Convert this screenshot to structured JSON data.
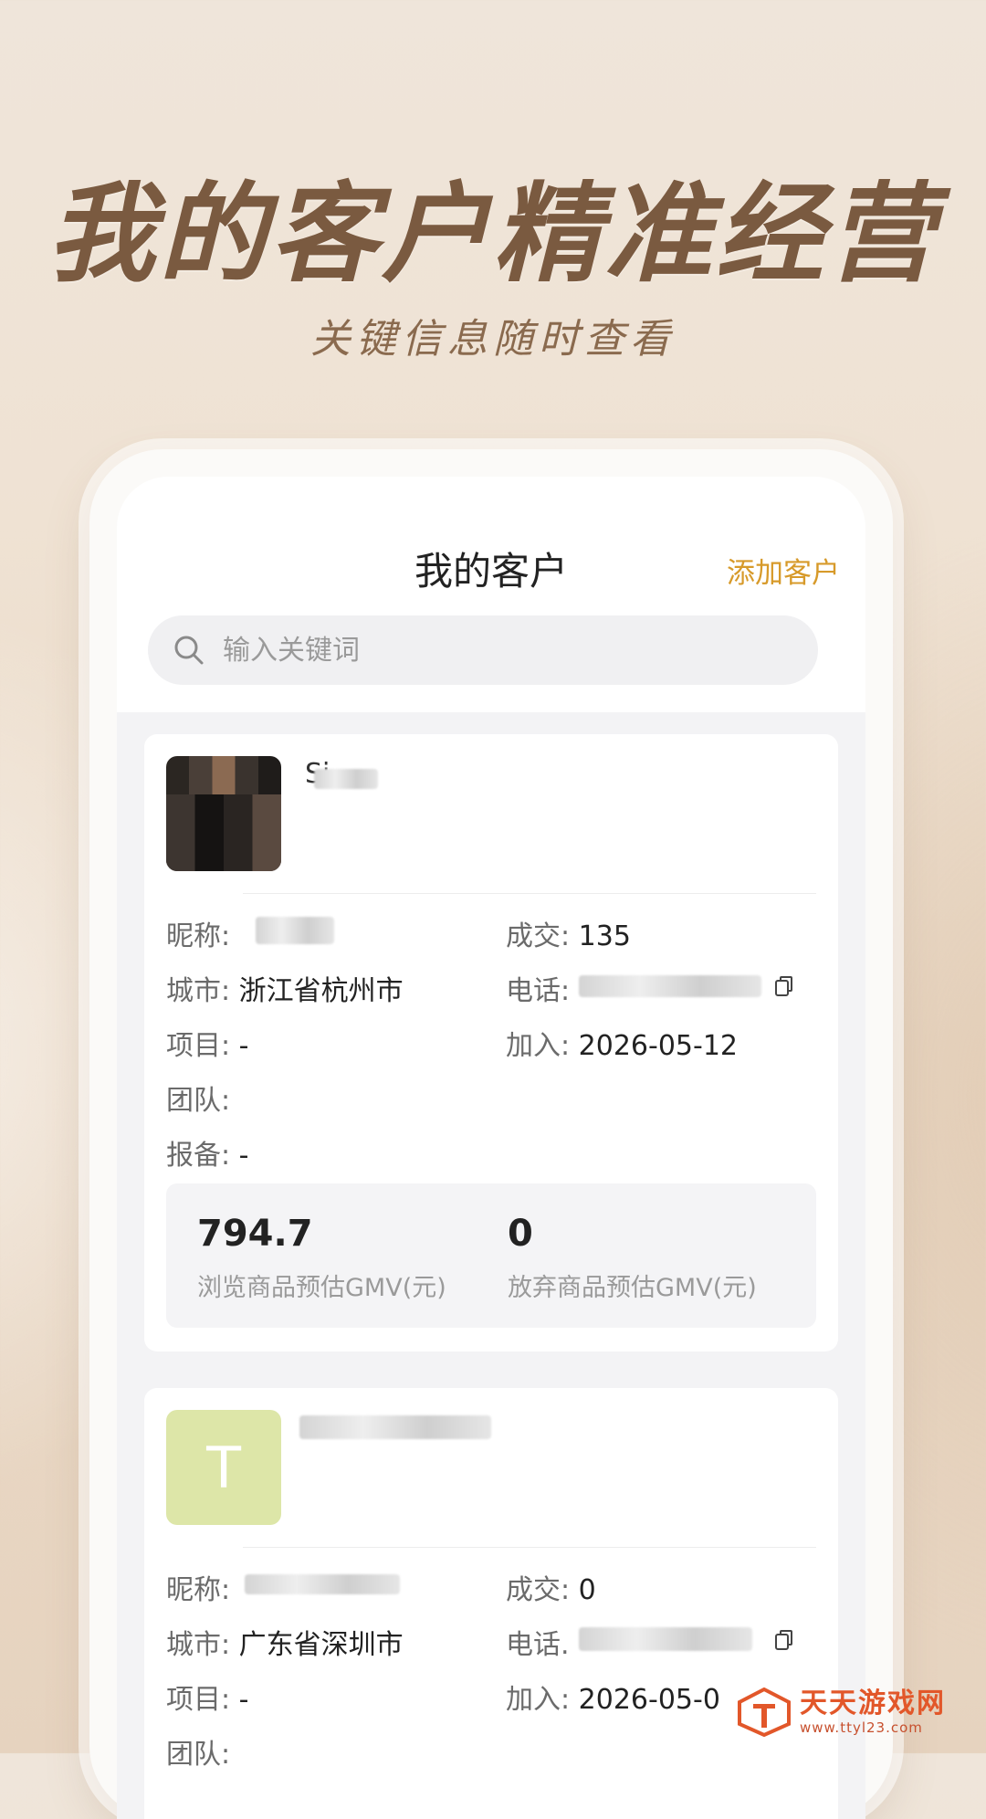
{
  "banner": {
    "headline": "我的客户精准经营",
    "subline": "关键信息随时查看"
  },
  "app": {
    "title": "我的客户",
    "add_label": "添加客户",
    "search_placeholder": "输入关键词"
  },
  "customers": [
    {
      "name": "Si",
      "avatar_letter": "",
      "nickname_label": "昵称:",
      "nickname": "",
      "deals_label": "成交:",
      "deals": "135",
      "city_label": "城市:",
      "city": "浙江省杭州市",
      "phone_label": "电话:",
      "phone": "",
      "project_label": "项目:",
      "project": "-",
      "joined_label": "加入:",
      "joined": "2026-05-12",
      "team_label": "团队:",
      "team": "",
      "report_label": "报备:",
      "report": "-",
      "browse_gmv": "794.7",
      "browse_gmv_label": "浏览商品预估GMV(元)",
      "abandon_gmv": "0",
      "abandon_gmv_label": "放弃商品预估GMV(元)"
    },
    {
      "name": "",
      "avatar_letter": "T",
      "nickname_label": "昵称:",
      "nickname": "",
      "deals_label": "成交:",
      "deals": "0",
      "city_label": "城市:",
      "city": "广东省深圳市",
      "phone_label": "电话.",
      "phone": "",
      "project_label": "项目:",
      "project": "-",
      "joined_label": "加入:",
      "joined": "2026-05-0",
      "team_label": "团队:",
      "team": ""
    }
  ],
  "watermark": {
    "name": "天天游戏网",
    "url": "www.ttyl23.com"
  },
  "colors": {
    "accent": "#d79a2a",
    "headline": "#7a5a40",
    "watermark": "#e2572a"
  }
}
